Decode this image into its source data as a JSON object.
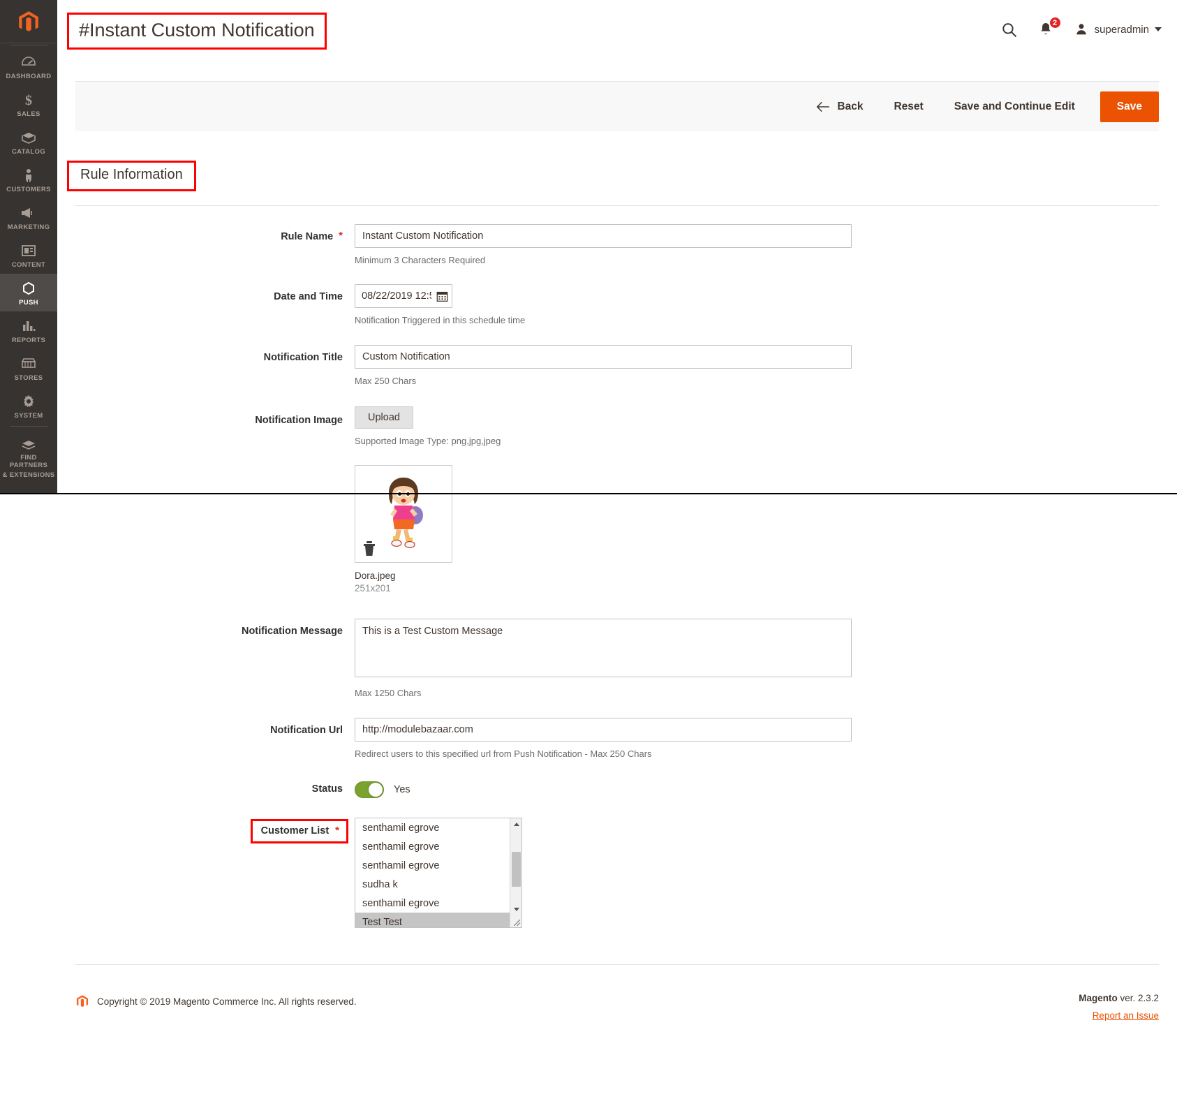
{
  "sidebar": {
    "logo": "magento-logo",
    "items": [
      {
        "label": "DASHBOARD",
        "icon": "dashboard-icon",
        "active": false
      },
      {
        "label": "SALES",
        "icon": "dollar-icon",
        "active": false
      },
      {
        "label": "CATALOG",
        "icon": "box-icon",
        "active": false
      },
      {
        "label": "CUSTOMERS",
        "icon": "person-icon",
        "active": false
      },
      {
        "label": "MARKETING",
        "icon": "megaphone-icon",
        "active": false
      },
      {
        "label": "CONTENT",
        "icon": "layout-icon",
        "active": false
      },
      {
        "label": "PUSH",
        "icon": "hexagon-icon",
        "active": true
      },
      {
        "label": "REPORTS",
        "icon": "bar-chart-icon",
        "active": false
      },
      {
        "label": "STORES",
        "icon": "storefront-icon",
        "active": false
      },
      {
        "label": "SYSTEM",
        "icon": "gear-icon",
        "active": false
      },
      {
        "label": "FIND PARTNERS\n& EXTENSIONS",
        "icon": "extensions-icon",
        "active": false
      }
    ],
    "find_partners_line1": "FIND PARTNERS",
    "find_partners_line2": "& EXTENSIONS"
  },
  "header": {
    "page_title": "#Instant Custom Notification",
    "search_icon": "search-icon",
    "notifications_icon": "bell-icon",
    "notifications_count": "2",
    "user_icon": "user-avatar-icon",
    "user_name": "superadmin",
    "caret_icon": "chevron-down-icon"
  },
  "action_bar": {
    "back_label": "Back",
    "back_icon": "arrow-left-icon",
    "reset_label": "Reset",
    "save_continue_label": "Save and Continue Edit",
    "save_label": "Save",
    "save_color": "#eb5202"
  },
  "section": {
    "title": "Rule Information"
  },
  "fields": {
    "rule_name": {
      "label": "Rule Name",
      "required": true,
      "value": "Instant Custom Notification",
      "note": "Minimum 3 Characters Required"
    },
    "date_time": {
      "label": "Date and Time",
      "required": false,
      "value": "08/22/2019 12:5",
      "note": "Notification Triggered in this schedule time",
      "calendar_icon": "calendar-icon"
    },
    "notification_title": {
      "label": "Notification Title",
      "required": false,
      "value": "Custom Notification",
      "note": "Max 250 Chars"
    },
    "notification_image": {
      "label": "Notification Image",
      "upload_label": "Upload",
      "note": "Supported Image Type: png,jpg,jpeg",
      "filename": "Dora.jpeg",
      "dimensions": "251x201",
      "delete_icon": "trash-icon",
      "preview_alt": "dora-cartoon-thumbnail"
    },
    "notification_message": {
      "label": "Notification Message",
      "value": "This is a Test Custom Message",
      "note": "Max 1250 Chars"
    },
    "notification_url": {
      "label": "Notification Url",
      "value": "http://modulebazaar.com",
      "note": "Redirect users to this specified url from Push Notification - Max 250 Chars"
    },
    "status": {
      "label": "Status",
      "toggle_value": "Yes",
      "toggle_on": true,
      "toggle_color": "#79a22e"
    },
    "customer_list": {
      "label": "Customer List",
      "required": true,
      "options": [
        {
          "label": "senthamil egrove",
          "selected": false
        },
        {
          "label": "senthamil egrove",
          "selected": false
        },
        {
          "label": "senthamil egrove",
          "selected": false
        },
        {
          "label": "sudha k",
          "selected": false
        },
        {
          "label": "senthamil egrove",
          "selected": false
        },
        {
          "label": "Test Test",
          "selected": true
        }
      ],
      "scroll_up_icon": "scroll-up-arrow-icon",
      "scroll_down_icon": "scroll-down-arrow-icon"
    }
  },
  "footer": {
    "logo_icon": "magento-logo-icon",
    "copyright": "Copyright © 2019 Magento Commerce Inc. All rights reserved.",
    "version_brand": "Magento",
    "version_text": " ver. 2.3.2",
    "report_issue": "Report an Issue"
  },
  "annotations": {
    "highlight_color": "#ff0000",
    "boxed": [
      "page-title",
      "section-title",
      "customer-list-label"
    ]
  }
}
